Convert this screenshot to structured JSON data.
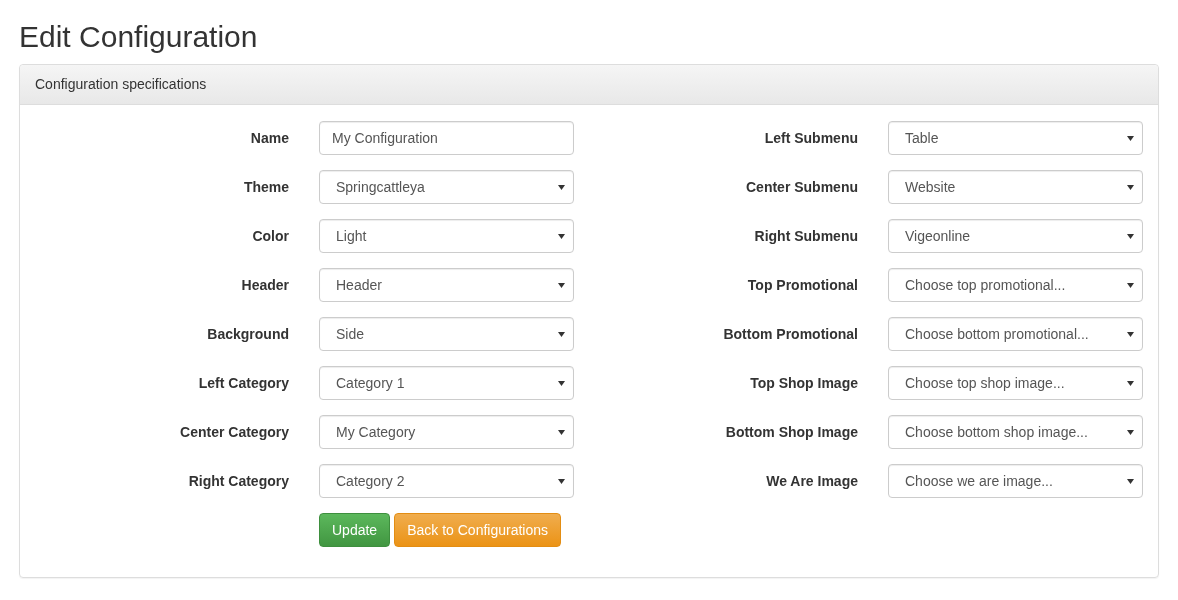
{
  "page_title": "Edit Configuration",
  "panel": {
    "heading": "Configuration specifications",
    "left_fields": [
      {
        "label": "Name",
        "kind": "text",
        "value": "My Configuration"
      },
      {
        "label": "Theme",
        "kind": "select",
        "value": "Springcattleya"
      },
      {
        "label": "Color",
        "kind": "select",
        "value": "Light"
      },
      {
        "label": "Header",
        "kind": "select",
        "value": "Header"
      },
      {
        "label": "Background",
        "kind": "select",
        "value": "Side"
      },
      {
        "label": "Left Category",
        "kind": "select",
        "value": "Category 1"
      },
      {
        "label": "Center Category",
        "kind": "select",
        "value": "My Category"
      },
      {
        "label": "Right Category",
        "kind": "select",
        "value": "Category 2"
      }
    ],
    "right_fields": [
      {
        "label": "Left Submenu",
        "kind": "select",
        "value": "Table"
      },
      {
        "label": "Center Submenu",
        "kind": "select",
        "value": "Website"
      },
      {
        "label": "Right Submenu",
        "kind": "select",
        "value": "Vigeonline"
      },
      {
        "label": "Top Promotional",
        "kind": "select",
        "value": "Choose top promotional..."
      },
      {
        "label": "Bottom Promotional",
        "kind": "select",
        "value": "Choose bottom promotional..."
      },
      {
        "label": "Top Shop Image",
        "kind": "select",
        "value": "Choose top shop image..."
      },
      {
        "label": "Bottom Shop Image",
        "kind": "select",
        "value": "Choose bottom shop image..."
      },
      {
        "label": "We Are Image",
        "kind": "select",
        "value": "Choose we are image..."
      }
    ],
    "buttons": [
      {
        "label": "Update",
        "kind": "success"
      },
      {
        "label": "Back to Configurations",
        "kind": "warning"
      }
    ]
  }
}
